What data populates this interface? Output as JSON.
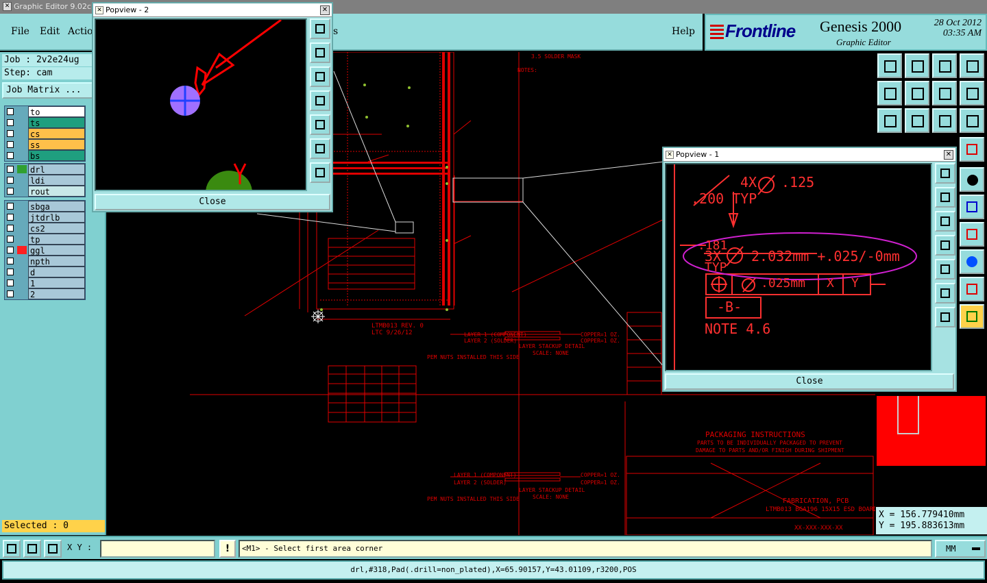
{
  "window": {
    "title": "Graphic Editor 9.02c"
  },
  "menu": {
    "file": "File",
    "edit": "Edit",
    "actions": "Actio",
    "options": "s",
    "help": "Help"
  },
  "brand": {
    "logo": "Frontline",
    "product": "Genesis 2000",
    "subtitle": "Graphic Editor",
    "date": "28 Oct 2012",
    "time": "03:35 AM"
  },
  "job": {
    "job": "Job : 2v2e24ug",
    "step": "Step: cam",
    "matrix": "Job Matrix ..."
  },
  "layers": {
    "group1": [
      {
        "name": "to",
        "color": "#ffffff"
      },
      {
        "name": "ts",
        "color": "#1f9f7f"
      },
      {
        "name": "cs",
        "color": "#ffc04a"
      },
      {
        "name": "ss",
        "color": "#ffc04a"
      },
      {
        "name": "bs",
        "color": "#1f9f7f"
      }
    ],
    "group2": [
      {
        "name": "drl",
        "color": "#a8c8d8",
        "swatch": "#30a030"
      },
      {
        "name": "ldi",
        "color": "#a8c8d8"
      },
      {
        "name": "rout",
        "color": "#c8e8e8"
      }
    ],
    "group3": [
      {
        "name": "sbga",
        "color": "#a8c8d8"
      },
      {
        "name": "jtdrlb",
        "color": "#a8c8d8"
      },
      {
        "name": "cs2",
        "color": "#a8c8d8"
      },
      {
        "name": "tp",
        "color": "#a8c8d8"
      },
      {
        "name": "ggl",
        "color": "#a8c8d8",
        "swatch": "#ff2020"
      },
      {
        "name": "npth",
        "color": "#a8c8d8"
      },
      {
        "name": "d",
        "color": "#a8c8d8"
      },
      {
        "name": "1",
        "color": "#a8c8d8"
      },
      {
        "name": "2",
        "color": "#a8c8d8"
      }
    ]
  },
  "selected": "Selected : 0",
  "popview2": {
    "title": "Popview - 2",
    "close": "Close"
  },
  "popview1": {
    "title": "Popview - 1",
    "close": "Close",
    "texts": {
      "t1": "4X",
      "t2": ".125",
      "t3": ".200 TYP",
      "t4": ".181",
      "t5": "3X",
      "t6": "2.032mm +.025/-0mm",
      "t7": "TYP",
      "t8": ".025mm",
      "t9": "X",
      "t10": "Y",
      "t11": "-B-",
      "t12": "NOTE 4.6"
    }
  },
  "canvas": {
    "packaging_title": "PACKAGING INSTRUCTIONS",
    "packaging_line1": "PARTS TO BE INDIVIDUALLY PACKAGED TO PREVENT",
    "packaging_line2": "DAMAGE TO PARTS AND/OR FINISH DURING SHIPMENT",
    "fab_pcb": "FABRICATION, PCB",
    "board": "LTMB013 BGA196 15X15 ESD BOARD",
    "part_no": "XX-XXX-XXX-XX",
    "rev": "LTMB013 REV. 0",
    "date": "LTC 9/26/12",
    "layer_stackup": "LAYER STACKUP DETAIL",
    "scale": "SCALE: NONE",
    "notes": "NOTES:",
    "solder_mask": "3.5 SOLDER MASK",
    "pem": "PEM NUTS INSTALLED THIS SIDE",
    "layer1": "LAYER 1 (COMPONENT)",
    "layer2": "LAYER 2 (SOLDER)",
    "copper1": "COPPER=1 OZ.",
    "copper2": "COPPER=1 OZ."
  },
  "coords": {
    "x": "X = 156.779410mm",
    "y": "Y = 195.883613mm"
  },
  "bottom": {
    "xy_label": "X Y :",
    "xy_value": "",
    "warn": "!",
    "prompt": "<M1> - Select first area corner",
    "units": "MM"
  },
  "status": "drl,#318,Pad(.drill=non_plated),X=65.90157,Y=43.01109,r3200,POS"
}
